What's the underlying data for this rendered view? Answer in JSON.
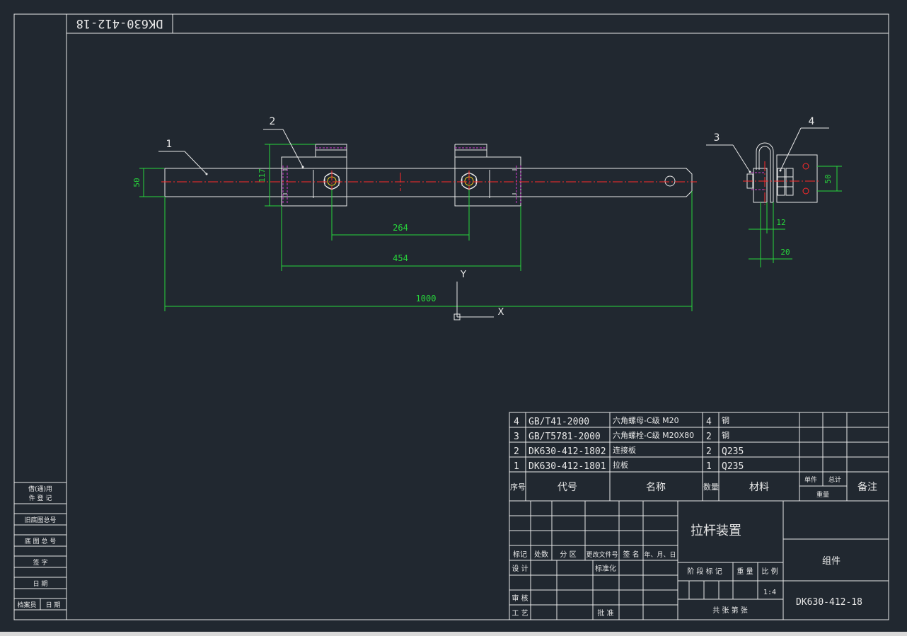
{
  "drawing": {
    "code_mirrored": "DK630-412-18",
    "title": "拉杆装置",
    "category": "组件",
    "number": "DK630-412-18",
    "scale": "1:4"
  },
  "colors": {
    "background": "#212830",
    "line": "#e8e8e8",
    "dimension": "#27d63b",
    "center": "#ff2a2a",
    "hidden": "#d23ad2"
  },
  "balloons": [
    "1",
    "2",
    "3",
    "4"
  ],
  "dimensions": {
    "d264": "264",
    "d454": "454",
    "d1000": "1000",
    "d50_left": "50",
    "d117": "117",
    "d50_right": "50",
    "d12": "12",
    "d20": "20"
  },
  "axes": {
    "x": "X",
    "y": "Y"
  },
  "bom": {
    "rows": [
      {
        "no": "4",
        "code": "GB/T41-2000",
        "name": "六角螺母-C级 M20",
        "qty": "4",
        "material": "钢"
      },
      {
        "no": "3",
        "code": "GB/T5781-2000",
        "name": "六角螺栓-C级 M20X80",
        "qty": "2",
        "material": "钢"
      },
      {
        "no": "2",
        "code": "DK630-412-1802",
        "name": "连接板",
        "qty": "2",
        "material": "Q235"
      },
      {
        "no": "1",
        "code": "DK630-412-1801",
        "name": "拉板",
        "qty": "1",
        "material": "Q235"
      }
    ],
    "header": {
      "no": "序号",
      "code": "代号",
      "name": "名称",
      "qty": "数量",
      "material": "材料",
      "single": "单件",
      "total": "总计",
      "weight": "重量",
      "remark": "备注"
    }
  },
  "title_block": {
    "mark": "标记",
    "count": "处数",
    "zone": "分 区",
    "change_doc": "更改文件号",
    "sign": "签 名",
    "date": "年、月、日",
    "design": "设 计",
    "standard": "标准化",
    "review": "审 核",
    "process": "工 艺",
    "approve": "批 准",
    "stage": "阶 段 标 记",
    "weight": "重 量",
    "ratio": "比 例",
    "sheets": "共   张  第   张"
  },
  "side_block": [
    "借(通)用",
    "件 登 记",
    "旧底图总号",
    "底 图 总 号",
    "签   字",
    "日   期",
    "档案员",
    "日 期"
  ]
}
